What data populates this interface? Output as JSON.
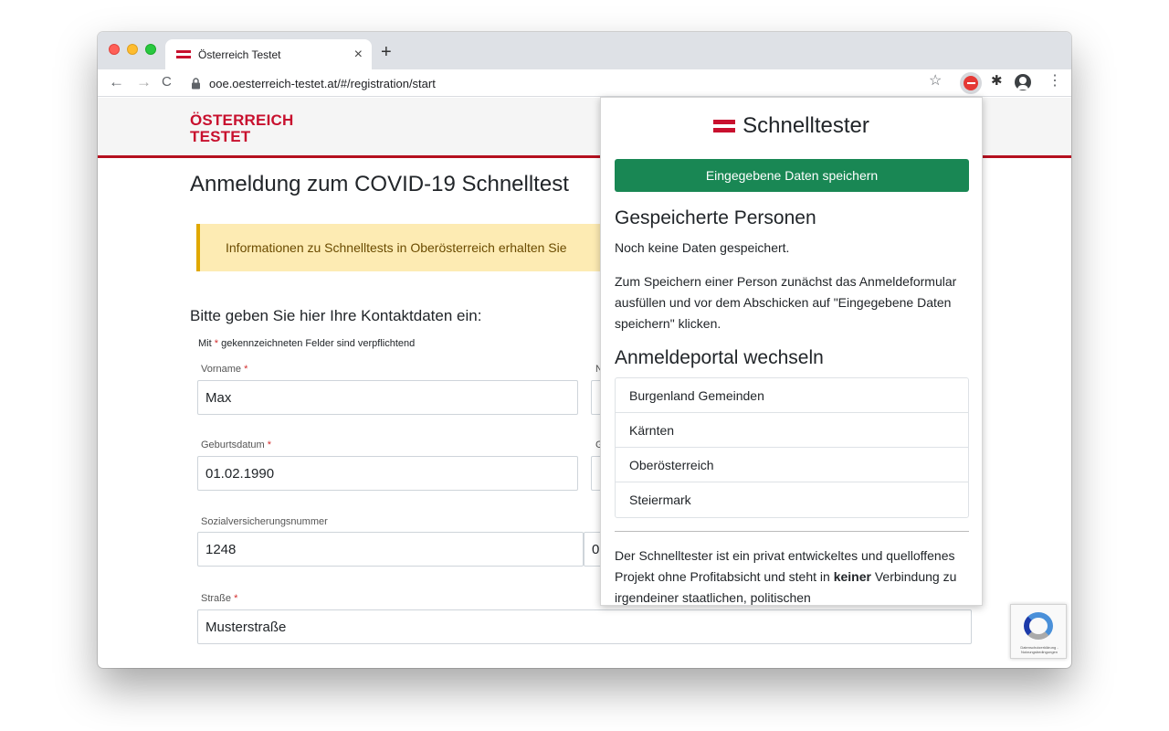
{
  "browser": {
    "tab_title": "Österreich Testet",
    "tab_close": "×",
    "new_tab": "+",
    "url": "ooe.oesterreich-testet.at/#/registration/start",
    "icons": [
      "back-arrow-icon",
      "forward-arrow-icon",
      "reload-icon",
      "lock-icon",
      "star-icon",
      "extension-icon",
      "puzzle-icon",
      "profile-icon",
      "menu-icon"
    ]
  },
  "flag_colors": {
    "red": "#c8102e",
    "white": "#ffffff"
  },
  "site": {
    "logo_line1": "ÖSTERREICH",
    "logo_line2": "TESTET",
    "page_title": "Anmeldung zum COVID-19 Schnelltest",
    "alert_text": "Informationen zu Schnelltests in Oberösterreich erhalten Sie",
    "section_title": "Bitte geben Sie hier Ihre Kontaktdaten ein:",
    "req_note_prefix": "Mit",
    "req_star": "*",
    "req_note_suffix": "gekennzeichneten Felder sind verpflichtend",
    "fields": {
      "vorname": {
        "label": "Vorname",
        "value": "Max"
      },
      "geburtsdatum": {
        "label": "Geburtsdatum",
        "value": "01.02.1990"
      },
      "svnr": {
        "label": "Sozialversicherungsnummer",
        "value": "1248",
        "value2": "0"
      },
      "strasse": {
        "label": "Straße",
        "value": "Musterstraße"
      },
      "col2_label_1": "N",
      "col2_label_2": "G"
    },
    "recaptcha_text": "Datenschutzerklärung - Nutzungsbedingungen"
  },
  "popup": {
    "title": "Schnelltester",
    "save_button": "Eingegebene Daten speichern",
    "saved_heading": "Gespeicherte Personen",
    "no_data": "Noch keine Daten gespeichert.",
    "instructions": "Zum Speichern einer Person zunächst das Anmeldeformular ausfüllen und vor dem Abschicken auf \"Eingegebene Daten speichern\" klicken.",
    "portal_heading": "Anmeldeportal wechseln",
    "portals": [
      "Burgenland Gemeinden",
      "Kärnten",
      "Oberösterreich",
      "Steiermark"
    ],
    "footer_part1": "Der Schnelltester ist ein privat entwickeltes und quelloffenes Projekt ohne Profitabsicht und steht in",
    "footer_bold": "keiner",
    "footer_part2": "Verbindung zu irgendeiner staatlichen, politischen"
  }
}
